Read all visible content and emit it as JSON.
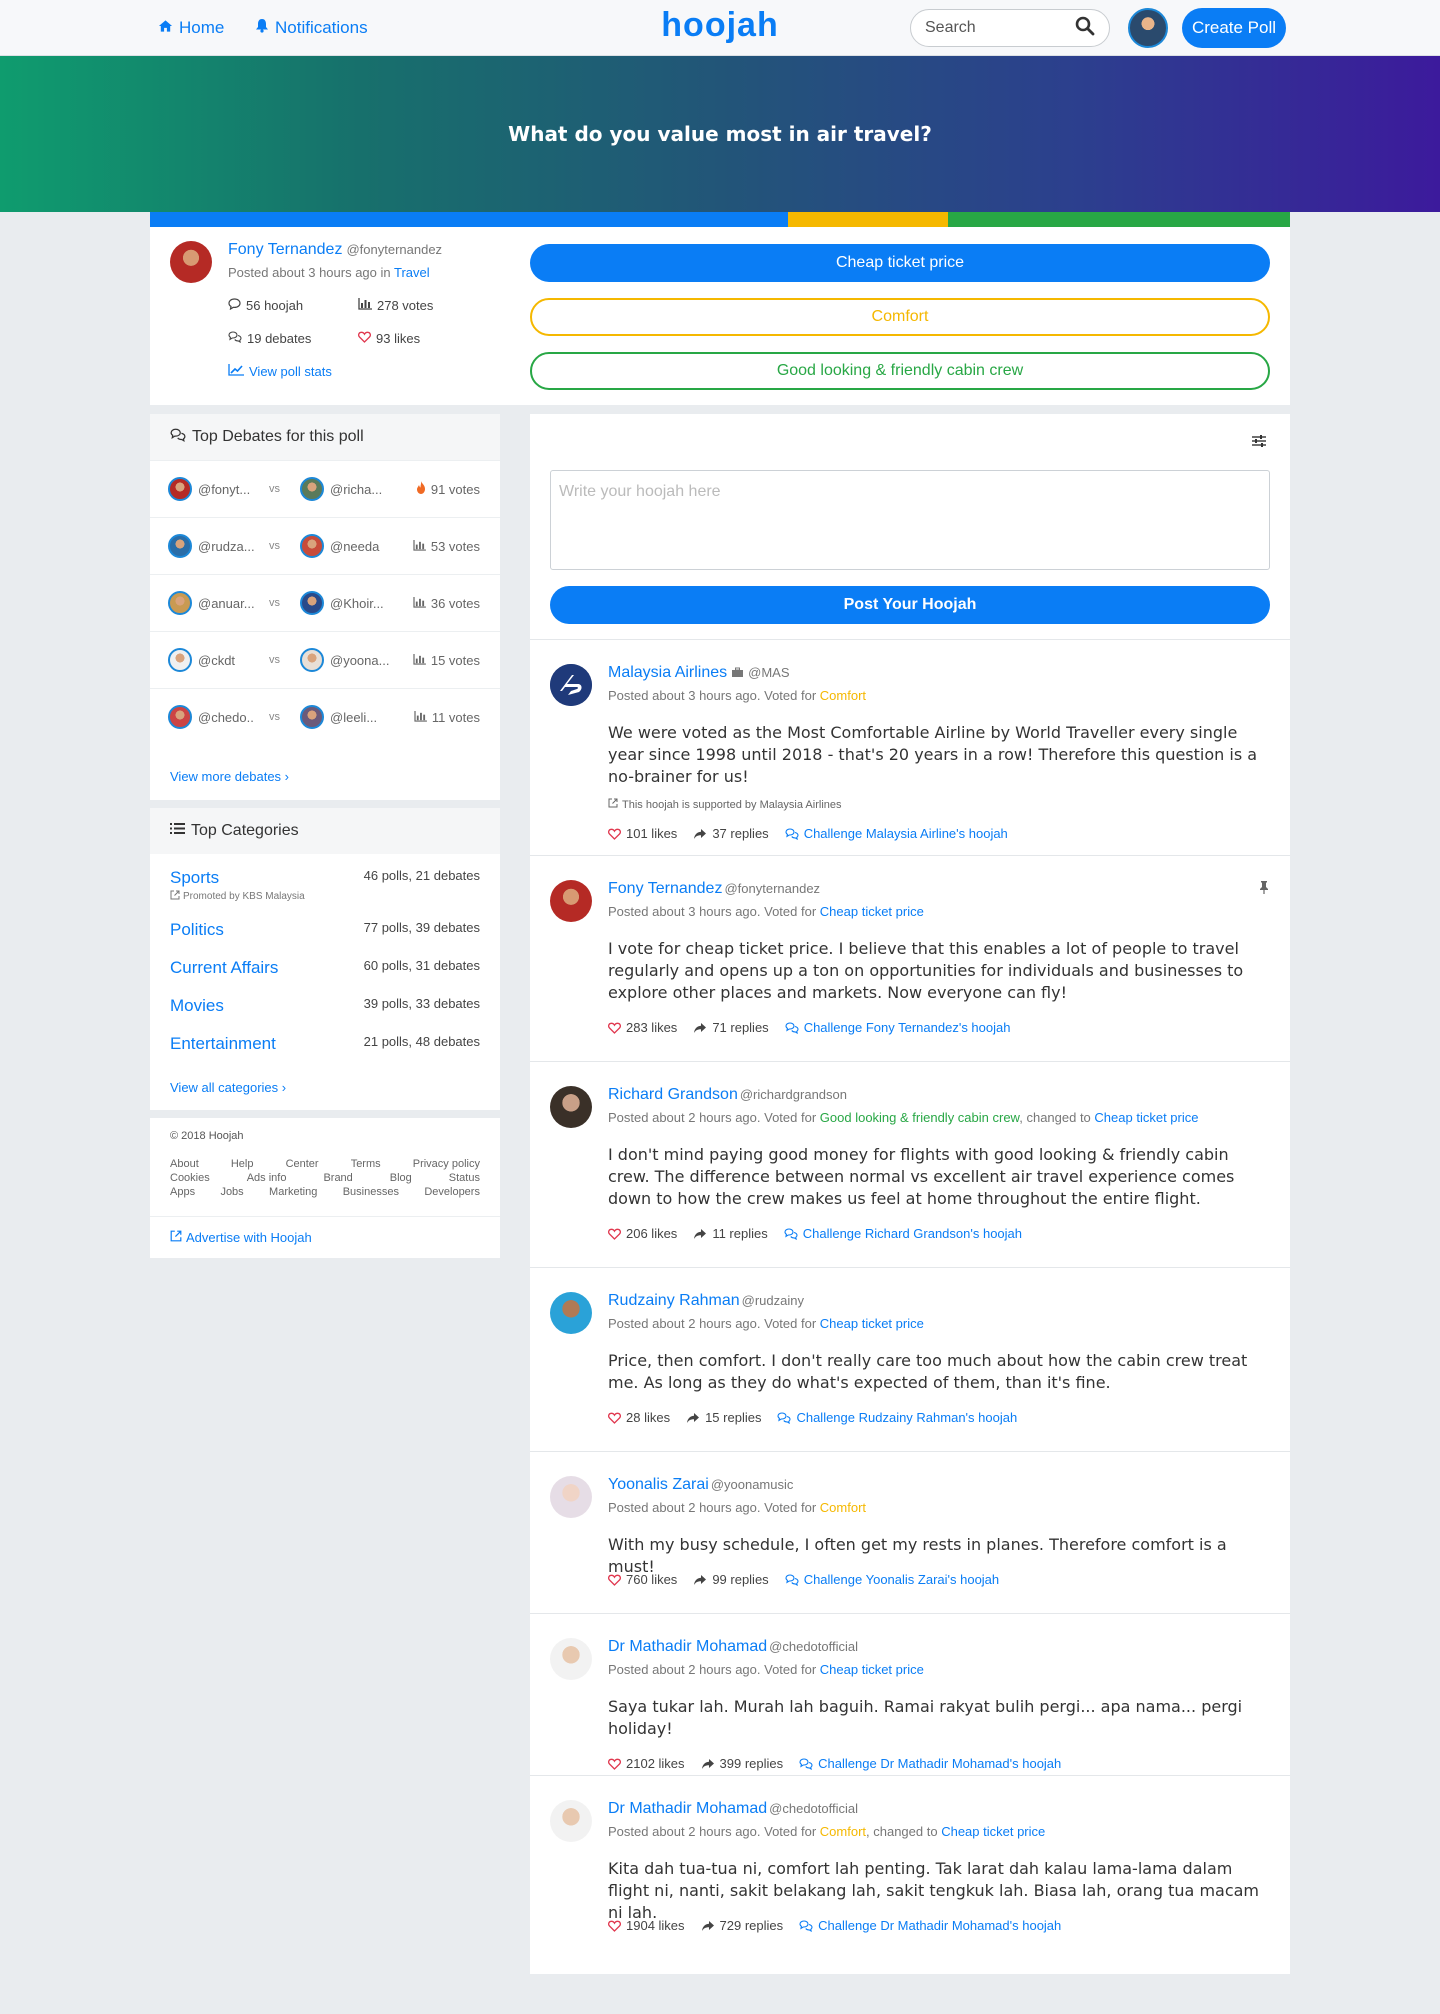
{
  "nav": {
    "home": "Home",
    "notifications": "Notifications",
    "brand": "hoojah",
    "search_placeholder": "Search",
    "create": "Create Poll"
  },
  "hero": {
    "question": "What do you value most in air travel?"
  },
  "colors": {
    "blue": "#0a7df5",
    "yellow": "#f5b800",
    "green": "#28a745"
  },
  "vote_share": {
    "cheap_ticket_price": 0.56,
    "comfort": 0.14,
    "cabin_crew": 0.3
  },
  "poll": {
    "author": "Fony Ternandez",
    "handle": "@fonyternandez",
    "posted": "Posted about 3 hours ago in",
    "category": "Travel",
    "hoojah": "56 hoojah",
    "votes": "278 votes",
    "debates": "19 debates",
    "likes": "93 likes",
    "stats_link": "View poll stats",
    "options": [
      "Cheap ticket price",
      "Comfort",
      "Good looking & friendly cabin crew"
    ]
  },
  "debates": {
    "title": "Top Debates for this poll",
    "rows": [
      {
        "a": "@fonyt...",
        "b": "@richa...",
        "votes": "91 votes"
      },
      {
        "a": "@rudza...",
        "b": "@needa",
        "votes": "53 votes"
      },
      {
        "a": "@anuar...",
        "b": "@Khoir...",
        "votes": "36 votes"
      },
      {
        "a": "@ckdt",
        "b": "@yoona...",
        "votes": "15 votes"
      },
      {
        "a": "@chedo..",
        "b": "@leeli...",
        "votes": "11 votes"
      }
    ],
    "vs": "vs",
    "more": "View more debates ›"
  },
  "categories": {
    "title": "Top Categories",
    "promoted": "Promoted by KBS Malaysia",
    "rows": [
      {
        "name": "Sports",
        "stats": "46 polls, 21 debates"
      },
      {
        "name": "Politics",
        "stats": "77 polls, 39 debates"
      },
      {
        "name": "Current Affairs",
        "stats": "60 polls, 31 debates"
      },
      {
        "name": "Movies",
        "stats": "39 polls, 33 debates"
      },
      {
        "name": "Entertainment",
        "stats": "21 polls, 48 debates"
      }
    ],
    "all": "View all categories ›"
  },
  "footer": {
    "copyright": "© 2018 Hoojah",
    "row1": [
      "About",
      "Help",
      "Center",
      "Terms",
      "Privacy policy"
    ],
    "row2": [
      "Cookies",
      "Ads info",
      "Brand",
      "Blog",
      "Status"
    ],
    "row3": [
      "Apps",
      "Jobs",
      "Marketing",
      "Businesses",
      "Developers"
    ],
    "advertise": "Advertise with Hoojah"
  },
  "composer": {
    "placeholder": "Write your hoojah here",
    "button": "Post Your Hoojah"
  },
  "posts": [
    {
      "name": "Malaysia Airlines",
      "handle": "@MAS",
      "meta": "Posted about 3 hours ago. Voted for",
      "vote": "Comfort",
      "text": "We were voted as the Most Comfortable Airline by World Traveller every single year since 1998 until 2018 - that's 20 years in a row! Therefore this question is a no-brainer for us!",
      "support": "This hoojah is supported by Malaysia Airlines",
      "likes": "101 likes",
      "replies": "37 replies",
      "challenge": "Challenge Malaysia Airline's hoojah"
    },
    {
      "name": "Fony Ternandez",
      "handle": "@fonyternandez",
      "meta": "Posted about 3 hours ago. Voted for",
      "vote": "Cheap ticket price",
      "text": "I vote for cheap ticket price. I believe that this enables a lot of people to travel regularly and opens up a ton on opportunities for individuals and businesses to explore other places and markets. Now everyone can fly!",
      "likes": "283 likes",
      "replies": "71 replies",
      "challenge": "Challenge Fony Ternandez's hoojah"
    },
    {
      "name": "Richard Grandson",
      "handle": "@richardgrandson",
      "meta": "Posted about 2 hours ago. Voted for",
      "vote": "Good looking & friendly cabin crew",
      "changed": ", changed to",
      "vote2": "Cheap ticket price",
      "text": "I don't mind paying good money for flights with good looking & friendly cabin crew. The difference between normal vs excellent air travel experience comes down to how the crew makes us feel at home throughout the entire flight.",
      "likes": "206 likes",
      "replies": "11 replies",
      "challenge": "Challenge Richard Grandson's hoojah"
    },
    {
      "name": "Rudzainy Rahman",
      "handle": "@rudzainy",
      "meta": "Posted about 2 hours ago. Voted for",
      "vote": "Cheap ticket price",
      "text": "Price, then comfort. I don't really care too much about how the cabin crew treat me. As long as they do what's expected of them, than it's fine.",
      "likes": "28 likes",
      "replies": "15 replies",
      "challenge": "Challenge Rudzainy Rahman's hoojah"
    },
    {
      "name": "Yoonalis Zarai",
      "handle": "@yoonamusic",
      "meta": "Posted about 2 hours ago. Voted for",
      "vote": "Comfort",
      "text": "With my busy schedule, I often get my rests in planes. Therefore comfort is a must!",
      "likes": "760 likes",
      "replies": "99 replies",
      "challenge": "Challenge Yoonalis Zarai's hoojah"
    },
    {
      "name": "Dr Mathadir Mohamad",
      "handle": "@chedotofficial",
      "meta": "Posted about 2 hours ago. Voted for",
      "vote": "Cheap ticket price",
      "text": "Saya tukar lah. Murah lah baguih. Ramai rakyat bulih pergi... apa nama... pergi holiday!",
      "likes": "2102 likes",
      "replies": "399 replies",
      "challenge": "Challenge Dr Mathadir Mohamad's hoojah"
    },
    {
      "name": "Dr Mathadir Mohamad",
      "handle": "@chedotofficial",
      "meta": "Posted about 2 hours ago. Voted for",
      "vote": "Comfort",
      "changed": ", changed to",
      "vote2": "Cheap ticket price",
      "text": "Kita dah tua-tua ni, comfort lah penting. Tak larat dah kalau lama-lama dalam flight ni, nanti, sakit belakang lah, sakit tengkuk lah. Biasa lah, orang tua macam ni lah.",
      "likes": "1904 likes",
      "replies": "729 replies",
      "challenge": "Challenge Dr Mathadir Mohamad's hoojah"
    }
  ]
}
